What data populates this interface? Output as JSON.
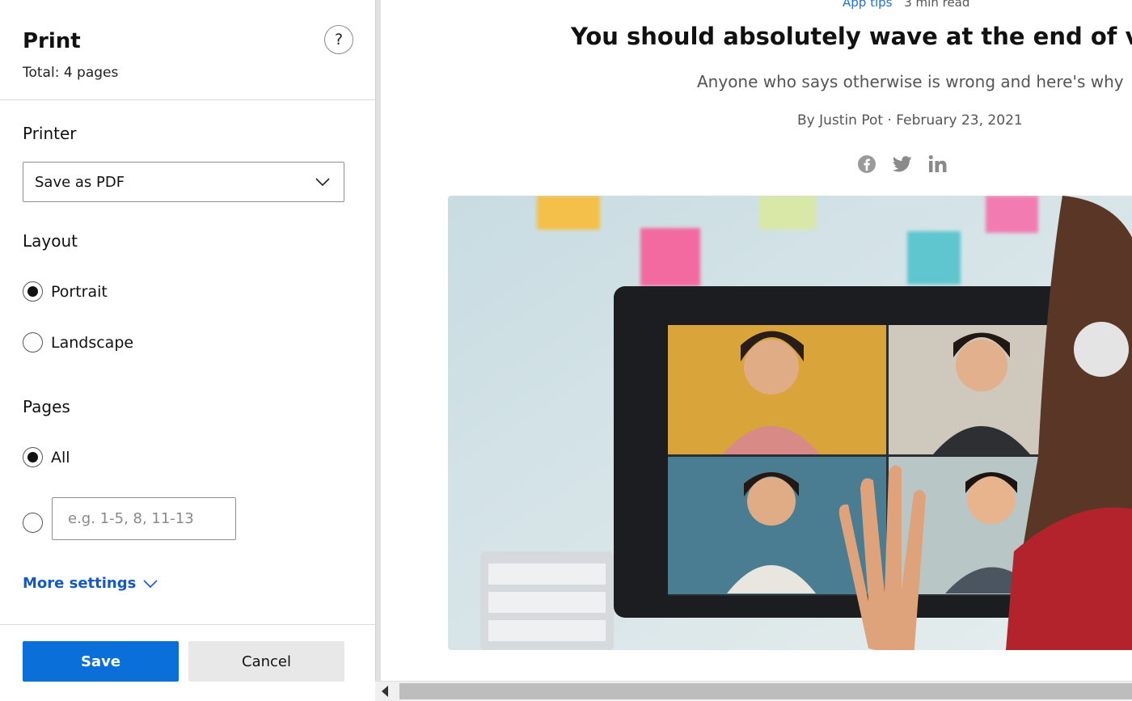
{
  "dialog": {
    "title": "Print",
    "total_pages": "Total: 4 pages",
    "help_label": "?",
    "printer": {
      "label": "Printer",
      "selected": "Save as PDF"
    },
    "layout": {
      "label": "Layout",
      "options": [
        "Portrait",
        "Landscape"
      ],
      "selected": "Portrait"
    },
    "pages": {
      "label": "Pages",
      "all_label": "All",
      "range_placeholder": "e.g. 1-5, 8, 11-13",
      "selected": "All"
    },
    "more_settings": "More settings",
    "save_label": "Save",
    "cancel_label": "Cancel",
    "accent_color": "#0a6fd8"
  },
  "preview": {
    "category": "App tips",
    "read_time": "3 min read",
    "headline": "You should absolutely wave at the end of vid",
    "subhead": "Anyone who says otherwise is wrong and here's why",
    "byline": "By Justin Pot · February 23, 2021",
    "social_icons": [
      "facebook-icon",
      "twitter-icon",
      "linkedin-icon"
    ],
    "hero_image": "people waving on a video call monitor"
  }
}
